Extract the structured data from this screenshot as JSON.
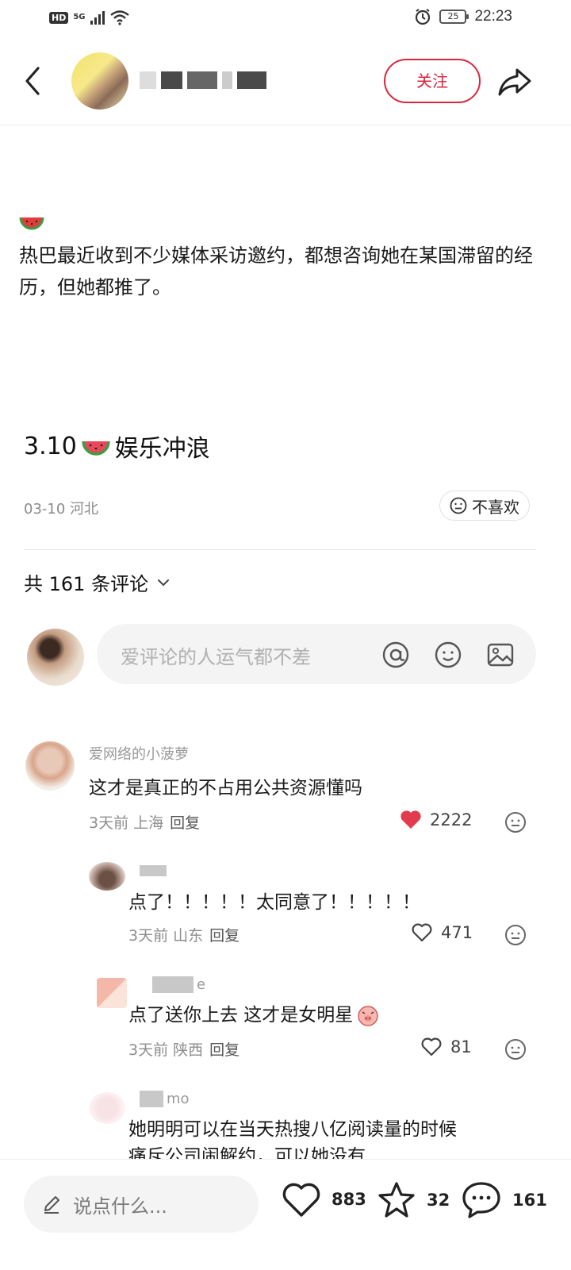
{
  "status_bar": {
    "hd": "HD",
    "network": "5G",
    "battery": "25",
    "time": "22:23"
  },
  "header": {
    "follow_label": "关注"
  },
  "post": {
    "body": "热巴最近收到不少媒体采访邀约，都想咨询她在某国滞留的经历，但她都推了。",
    "tag_date": "3.10",
    "tag_text": "娱乐冲浪",
    "meta": "03-10 河北",
    "dislike_label": "不喜欢"
  },
  "comments_section": {
    "count_label": "共 161 条评论",
    "input_placeholder": "爱评论的人运气都不差"
  },
  "comments": [
    {
      "name": "爱网络的小菠萝",
      "text": "这才是真正的不占用公共资源懂吗",
      "time_loc": "3天前 上海",
      "reply": "回复",
      "likes": "2222",
      "liked": true
    },
    {
      "name": "",
      "text": "点了！！！！！太同意了！！！！！",
      "time_loc": "3天前 山东",
      "reply": "回复",
      "likes": "471",
      "liked": false
    },
    {
      "name": "e",
      "text": "点了送你上去 这才是女明星",
      "time_loc": "3天前 陕西",
      "reply": "回复",
      "likes": "81",
      "liked": false
    },
    {
      "name": "mo",
      "text": "她明明可以在当天热搜八亿阅读量的时候",
      "text2": "痛斥公司闹解约，可以她没有",
      "time_loc": "",
      "reply": "",
      "likes": "",
      "liked": false
    }
  ],
  "bottom_bar": {
    "say_placeholder": "说点什么...",
    "likes": "883",
    "stars": "32",
    "comments": "161"
  },
  "colors": {
    "accent": "#d7263d",
    "text": "#1a1a1a",
    "muted": "#8d8d8d",
    "input_bg": "#f4f4f4"
  }
}
